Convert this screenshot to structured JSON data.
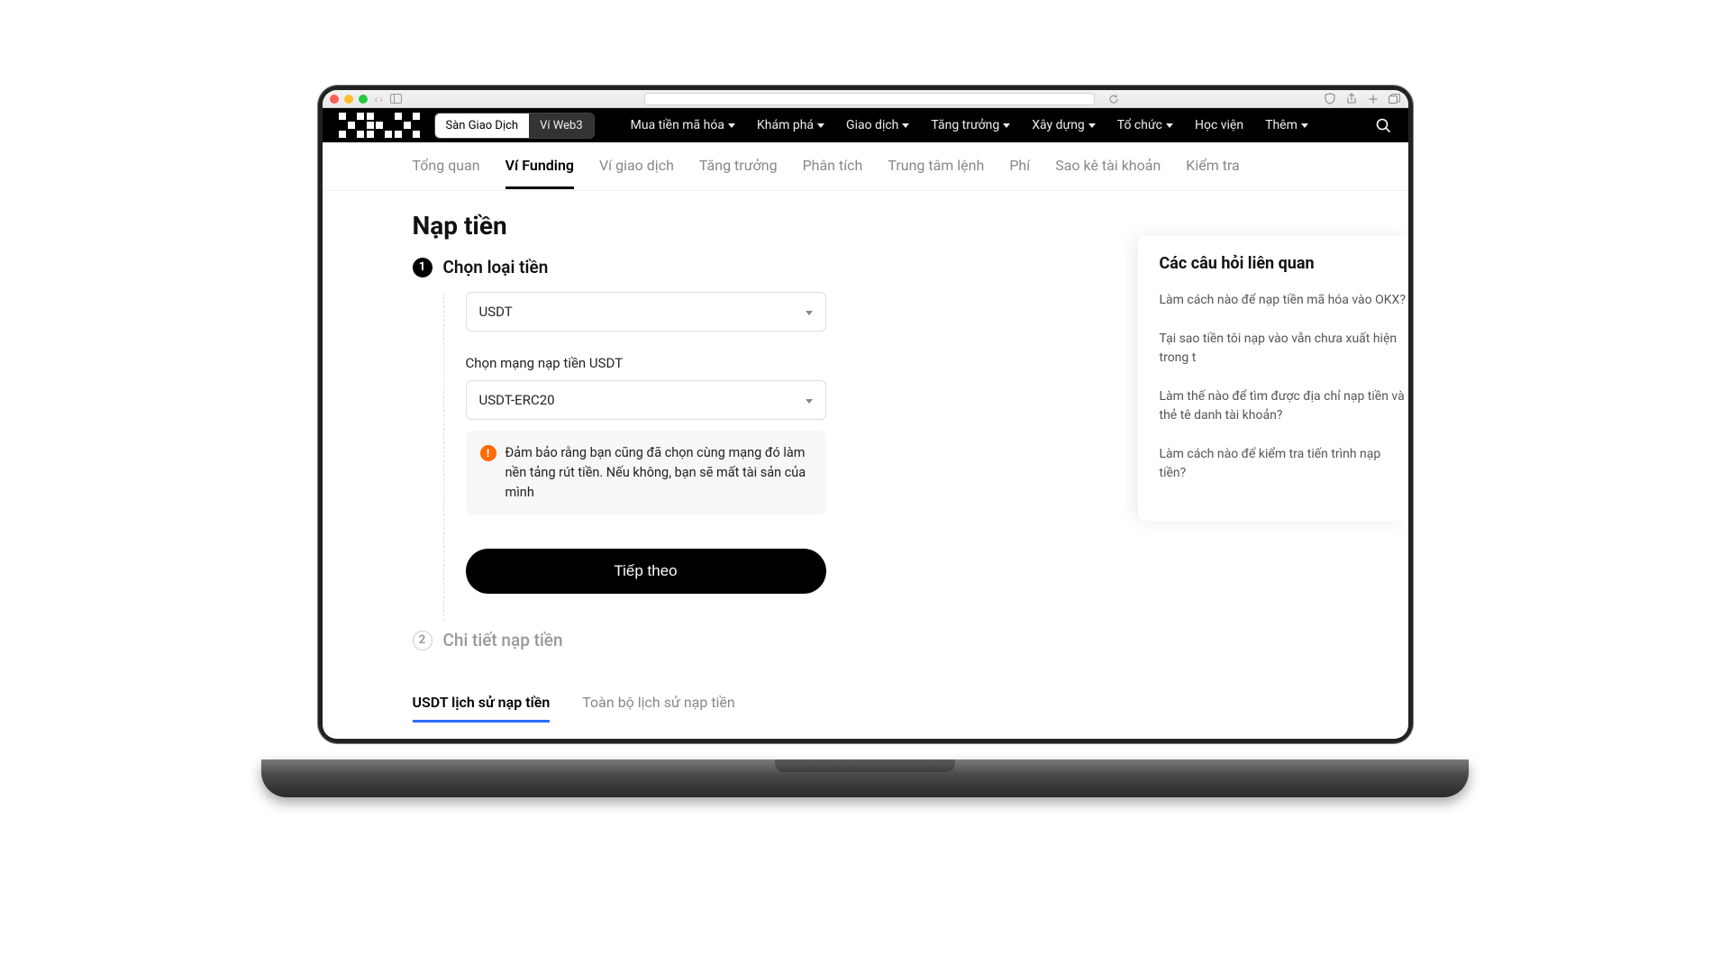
{
  "segmented": {
    "exchange": "Sàn Giao Dịch",
    "web3": "Ví Web3"
  },
  "main_nav": [
    {
      "label": "Mua tiền mã hóa",
      "dropdown": true
    },
    {
      "label": "Khám phá",
      "dropdown": true
    },
    {
      "label": "Giao dịch",
      "dropdown": true
    },
    {
      "label": "Tăng trưởng",
      "dropdown": true
    },
    {
      "label": "Xây dựng",
      "dropdown": true
    },
    {
      "label": "Tổ chức",
      "dropdown": true
    },
    {
      "label": "Học viện",
      "dropdown": false
    },
    {
      "label": "Thêm",
      "dropdown": true
    }
  ],
  "sub_tabs": [
    "Tổng quan",
    "Ví Funding",
    "Ví giao dịch",
    "Tăng trưởng",
    "Phân tích",
    "Trung tâm lệnh",
    "Phí",
    "Sao kê tài khoản",
    "Kiểm tra"
  ],
  "sub_tabs_active": 1,
  "page_title": "Nạp tiền",
  "step1": {
    "number": "1",
    "title": "Chọn loại tiền",
    "currency_value": "USDT",
    "network_label": "Chọn mạng nạp tiền USDT",
    "network_value": "USDT-ERC20",
    "warning": "Đảm bảo rằng bạn cũng đã chọn cùng mạng đó làm nền tảng rút tiền. Nếu không, bạn sẽ mất tài sản của mình",
    "next_button": "Tiếp theo"
  },
  "step2": {
    "number": "2",
    "title": "Chi tiết nạp tiền"
  },
  "history_tabs": {
    "active": "USDT lịch sử nạp tiền",
    "all": "Toàn bộ lịch sử nạp tiền"
  },
  "faq": {
    "title": "Các câu hỏi liên quan",
    "items": [
      "Làm cách nào để nạp tiền mã hóa vào OKX?",
      "Tại sao tiền tôi nạp vào vẫn chưa xuất hiện trong t",
      "Làm thế nào để tìm được địa chỉ nạp tiền và thẻ tê danh tài khoản?",
      "Làm cách nào để kiểm tra tiến trình nạp tiền?"
    ]
  }
}
